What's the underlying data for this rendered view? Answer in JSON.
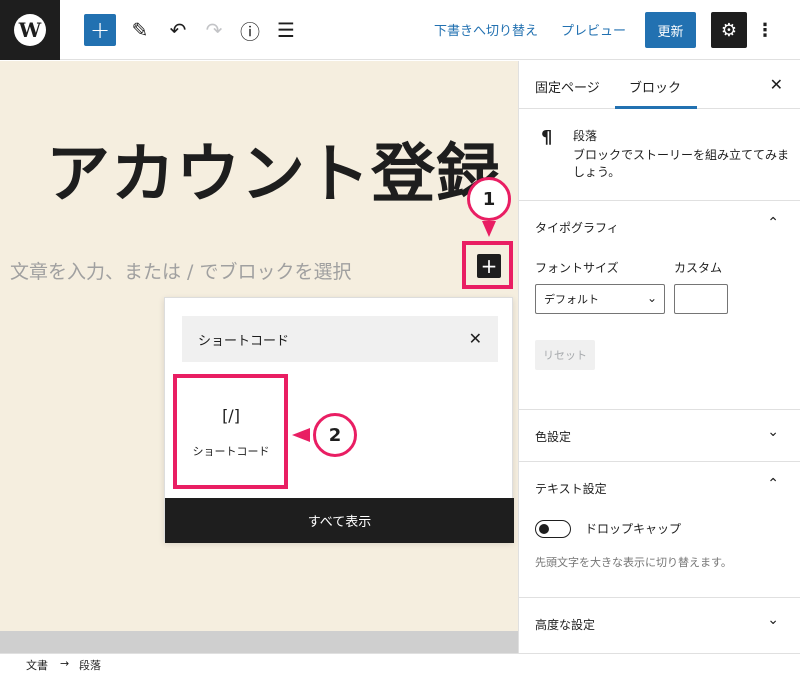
{
  "toolbar": {
    "logo": "W",
    "add_icon": "+",
    "pen_icon": "✎",
    "undo_icon": "↶",
    "redo_icon": "↷",
    "info_icon": "ⓘ",
    "list_icon": "☰",
    "switch_draft": "下書きへ切り替え",
    "preview": "プレビュー",
    "update": "更新",
    "settings_icon": "⚙",
    "more_icon": "⋮"
  },
  "editor": {
    "title": "アカウント登録",
    "placeholder": "文章を入力、または / でブロックを選択",
    "inserter_toggle": "+"
  },
  "callouts": {
    "one": "1",
    "two": "2"
  },
  "inserter": {
    "search_value": "ショートコード",
    "clear_icon": "✕",
    "result": {
      "icon": "[/]",
      "label": "ショートコード"
    },
    "show_all": "すべて表示"
  },
  "sidebar": {
    "tabs": [
      {
        "label": "固定ページ"
      },
      {
        "label": "ブロック"
      }
    ],
    "close_icon": "✕",
    "block_card": {
      "icon": "¶",
      "name": "段落",
      "description": "ブロックでストーリーを組み立ててみましょう。"
    },
    "typography": {
      "title": "タイポグラフィ",
      "font_size_label": "フォントサイズ",
      "custom_label": "カスタム",
      "font_size_value": "デフォルト",
      "custom_value": "",
      "reset": "リセット"
    },
    "color": {
      "title": "色設定"
    },
    "text": {
      "title": "テキスト設定",
      "dropcap_label": "ドロップキャップ",
      "dropcap_help": "先頭文字を大きな表示に切り替えます。",
      "dropcap_on": false
    },
    "advanced": {
      "title": "高度な設定"
    },
    "chevron_up": "⌃",
    "chevron_down": "⌄"
  },
  "breadcrumb": {
    "doc": "文書",
    "sep": "→",
    "block": "段落"
  },
  "colors": {
    "accent": "#2271b1",
    "highlight": "#e91e63",
    "canvas": "#f5eedf"
  }
}
